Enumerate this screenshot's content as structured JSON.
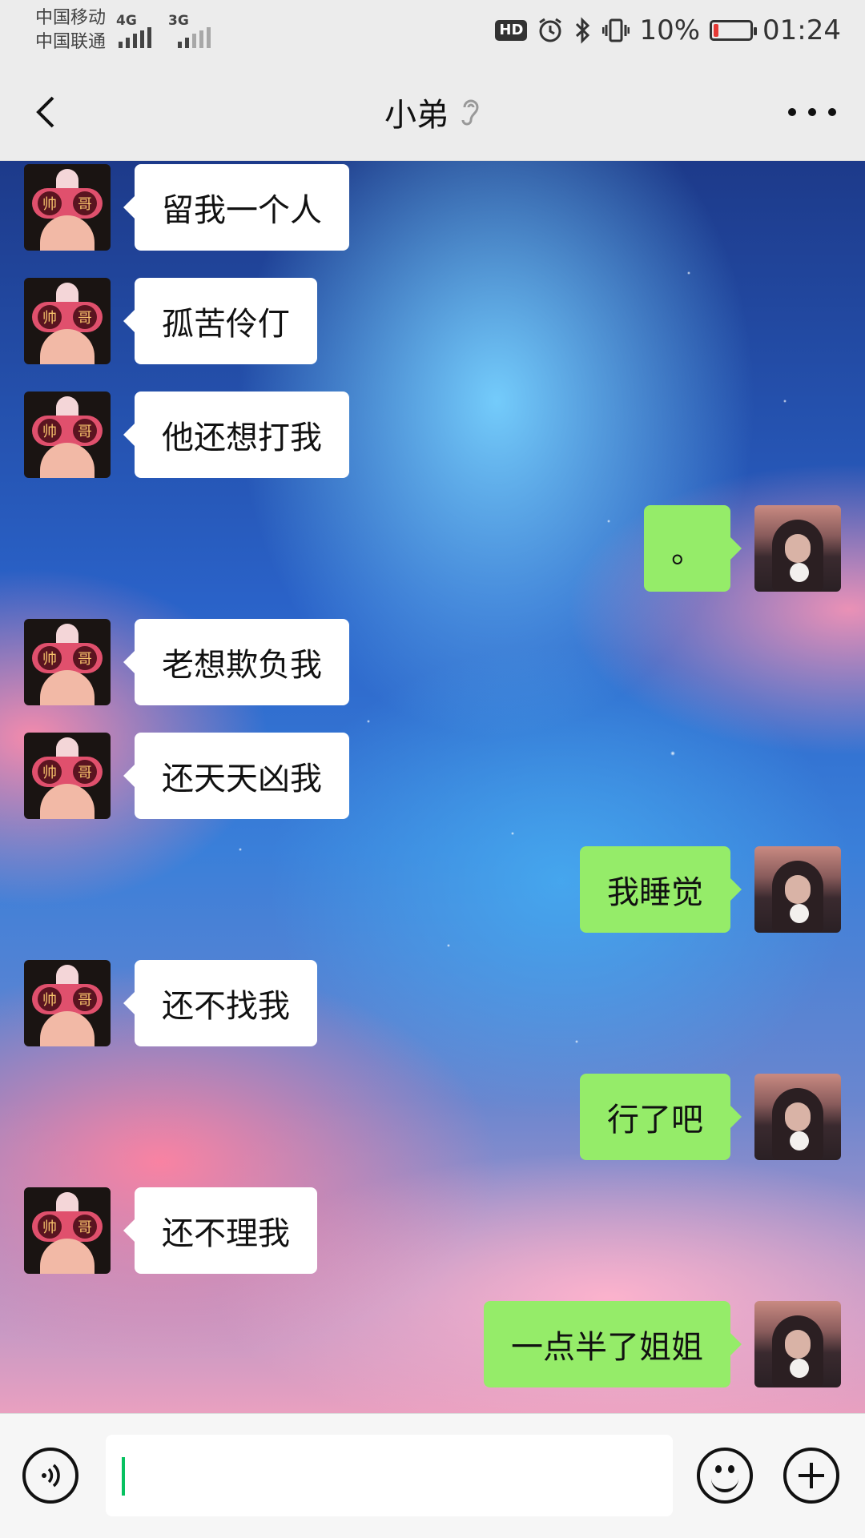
{
  "status_bar": {
    "carrier_1": "中国移动",
    "carrier_2": "中国联通",
    "network_1": "4G",
    "network_2": "3G",
    "hd_badge": "HD",
    "battery_percent": "10%",
    "time": "01:24",
    "icons": [
      "alarm-icon",
      "bluetooth-icon",
      "vibrate-icon",
      "battery-icon"
    ],
    "battery_color": "#e53935"
  },
  "header": {
    "title": "小弟",
    "icons": [
      "back-icon",
      "earpiece-icon",
      "more-icon"
    ]
  },
  "messages": [
    {
      "side": "left",
      "text": "留我一个人"
    },
    {
      "side": "left",
      "text": "孤苦伶仃"
    },
    {
      "side": "left",
      "text": "他还想打我"
    },
    {
      "side": "right",
      "text": "。"
    },
    {
      "side": "left",
      "text": "老想欺负我"
    },
    {
      "side": "left",
      "text": "还天天凶我"
    },
    {
      "side": "right",
      "text": "我睡觉"
    },
    {
      "side": "left",
      "text": "还不找我"
    },
    {
      "side": "right",
      "text": "行了吧"
    },
    {
      "side": "left",
      "text": "还不理我"
    },
    {
      "side": "right",
      "text": "一点半了姐姐"
    }
  ],
  "friend_avatar_text": [
    "帅",
    "哥"
  ],
  "input_bar": {
    "value": "",
    "icons": [
      "voice-icon",
      "emoji-icon",
      "plus-icon"
    ]
  },
  "colors": {
    "self_bubble": "#95ec69",
    "friend_bubble": "#ffffff",
    "cursor": "#07c160"
  }
}
